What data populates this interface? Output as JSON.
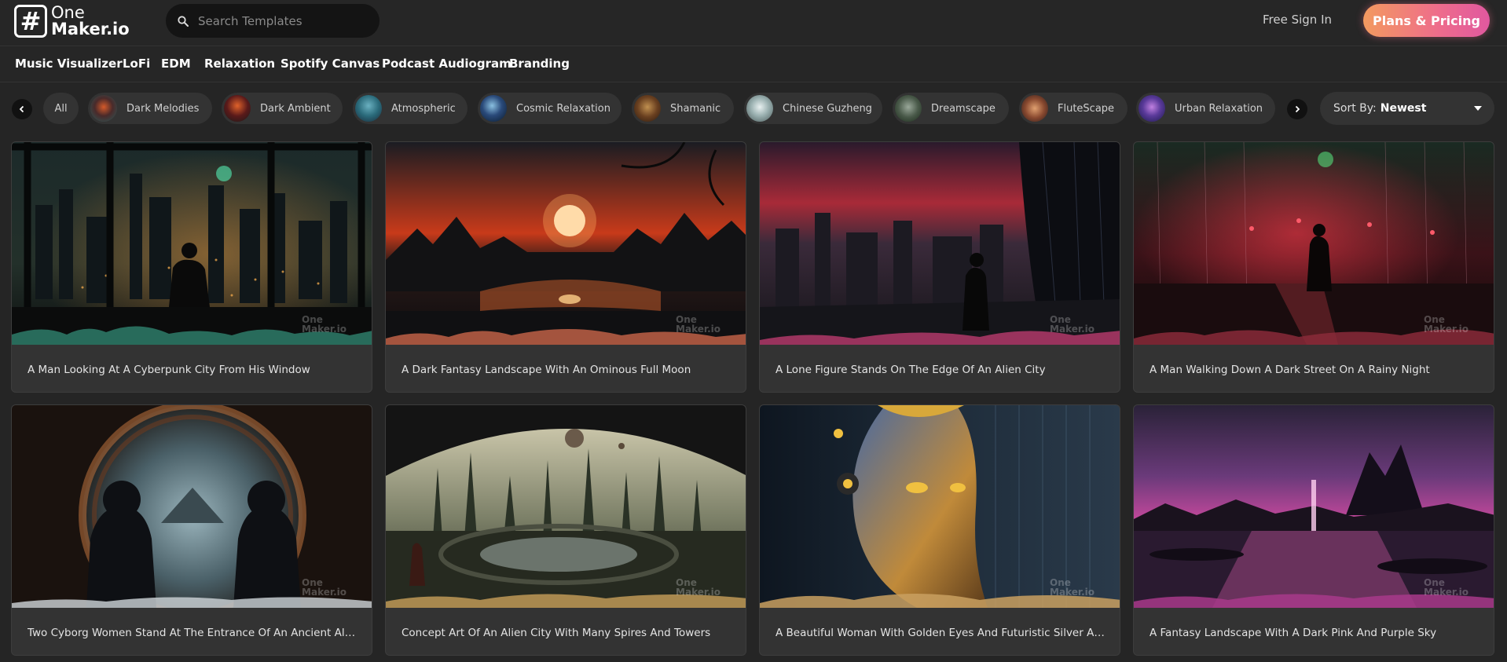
{
  "header": {
    "logo_line1": "One",
    "logo_line2": "Maker.io",
    "search_placeholder": "Search Templates",
    "signin_label": "Free Sign In",
    "plans_label": "Plans & Pricing"
  },
  "nav": {
    "items": [
      "Music Visualizer",
      "LoFi",
      "EDM",
      "Relaxation",
      "Spotify Canvas",
      "Podcast Audiogram",
      "Branding"
    ]
  },
  "chips": {
    "all_label": "All",
    "items": [
      "Dark Melodies",
      "Dark Ambient",
      "Atmospheric",
      "Cosmic Relaxation",
      "Shamanic",
      "Chinese Guzheng",
      "Dreamscape",
      "FluteScape",
      "Urban Relaxation"
    ]
  },
  "sort": {
    "prefix": "Sort By:",
    "value": "Newest"
  },
  "cards": [
    {
      "title": "A Man Looking At A Cyberpunk City From His Window"
    },
    {
      "title": "A Dark Fantasy Landscape With An Ominous Full Moon"
    },
    {
      "title": "A Lone Figure Stands On The Edge Of An Alien City"
    },
    {
      "title": "A Man Walking Down A Dark Street On A Rainy Night"
    },
    {
      "title": "Two Cyborg Women Stand At The Entrance Of An Ancient Alien S..."
    },
    {
      "title": "Concept Art Of An Alien City With Many Spires And Towers"
    },
    {
      "title": "A Beautiful Woman With Golden Eyes And Futuristic Silver Armor..."
    },
    {
      "title": "A Fantasy Landscape With A Dark Pink And Purple Sky"
    }
  ],
  "watermark": {
    "line1": "One",
    "line2": "Maker.io"
  },
  "colors": {
    "accent_gradient_start": "#f39a5f",
    "accent_gradient_end": "#e0589f",
    "background": "#252525"
  }
}
